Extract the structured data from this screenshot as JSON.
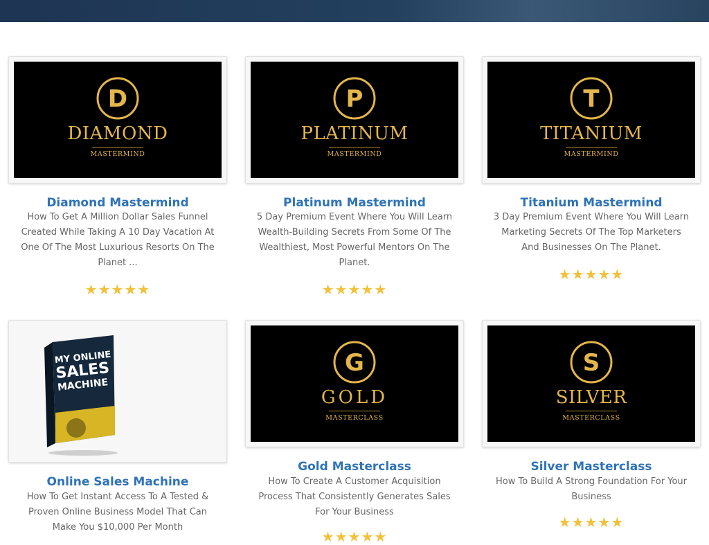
{
  "products": [
    {
      "title": "Diamond Mastermind",
      "brand": "DIAMOND",
      "sub": "MASTERMIND",
      "letter": "D",
      "desc_lines": [
        "How To Get A Million Dollar Sales Funnel",
        "Created While Taking A 10 Day Vacation At",
        "One Of The Most Luxurious Resorts On The",
        "Planet ..."
      ],
      "stars": "★★★★★"
    },
    {
      "title": "Platinum Mastermind",
      "brand": "PLATINUM",
      "sub": "MASTERMIND",
      "letter": "P",
      "desc_lines": [
        "5 Day Premium Event Where You Will Learn",
        "Wealth-Building Secrets From Some Of The",
        "Wealthiest, Most Powerful Mentors On The",
        "Planet."
      ],
      "stars": "★★★★★"
    },
    {
      "title": "Titanium Mastermind",
      "brand": "TITANIUM",
      "sub": "MASTERMIND",
      "letter": "T",
      "desc_lines": [
        "3 Day Premium Event Where You Will Learn",
        "Marketing Secrets Of The Top Marketers",
        "And Businesses On The Planet."
      ],
      "stars": "★★★★★"
    },
    {
      "title": "Online Sales Machine",
      "book_lines": [
        "MY ONLINE",
        "SALES",
        "MACHINE"
      ],
      "desc_lines": [
        "How To Get Instant Access To A Tested &",
        "Proven Online Business Model That Can",
        "Make You $10,000 Per Month"
      ]
    },
    {
      "title": "Gold Masterclass",
      "brand": "GOLD",
      "sub": "MASTERCLASS",
      "letter": "G",
      "desc_lines": [
        "How To Create A Customer Acquisition",
        "Process That Consistently Generates Sales",
        "For Your Business"
      ],
      "stars": "★★★★★"
    },
    {
      "title": "Silver Masterclass",
      "brand": "SILVER",
      "sub": "MASTERCLASS",
      "letter": "S",
      "desc_lines": [
        "How To Build A Strong Foundation For Your",
        "Business"
      ],
      "stars": "★★★★★"
    }
  ],
  "colors": {
    "gold": "#e4b64b",
    "title_blue": "#2f73b7",
    "star": "#f2c13a"
  }
}
